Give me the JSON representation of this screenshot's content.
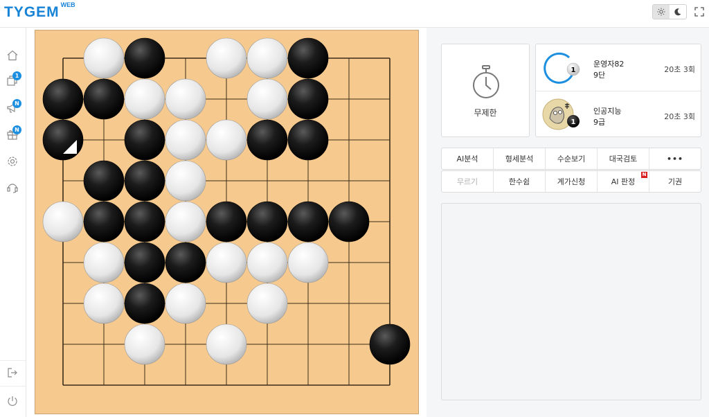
{
  "app": {
    "logo_text": "TYGEM",
    "logo_suffix": "WEB",
    "brand_color": "#1783d6"
  },
  "header": {
    "theme_light_icon": "sun-icon",
    "theme_dark_icon": "moon-icon",
    "fullscreen_icon": "fullscreen-icon"
  },
  "sidebar": {
    "items": [
      {
        "icon": "home-icon",
        "badge": ""
      },
      {
        "icon": "boxes-icon",
        "badge": "1"
      },
      {
        "icon": "megaphone-icon",
        "badge": "N"
      },
      {
        "icon": "gift-icon",
        "badge": "N"
      },
      {
        "icon": "settings-icon",
        "badge": ""
      },
      {
        "icon": "support-icon",
        "badge": ""
      }
    ],
    "bottom": [
      {
        "icon": "logout-icon"
      },
      {
        "icon": "power-icon"
      }
    ],
    "badge_color": "#1c8fe0"
  },
  "board": {
    "size": 9,
    "color": "#f6c98e",
    "stones": [
      {
        "c": "W",
        "col": 1,
        "row": 0
      },
      {
        "c": "B",
        "col": 2,
        "row": 0
      },
      {
        "c": "W",
        "col": 4,
        "row": 0
      },
      {
        "c": "W",
        "col": 5,
        "row": 0
      },
      {
        "c": "B",
        "col": 6,
        "row": 0
      },
      {
        "c": "B",
        "col": 0,
        "row": 1
      },
      {
        "c": "B",
        "col": 1,
        "row": 1
      },
      {
        "c": "W",
        "col": 2,
        "row": 1
      },
      {
        "c": "W",
        "col": 3,
        "row": 1
      },
      {
        "c": "W",
        "col": 5,
        "row": 1
      },
      {
        "c": "B",
        "col": 6,
        "row": 1
      },
      {
        "c": "B",
        "col": 0,
        "row": 2,
        "last": true
      },
      {
        "c": "B",
        "col": 2,
        "row": 2
      },
      {
        "c": "W",
        "col": 3,
        "row": 2
      },
      {
        "c": "W",
        "col": 4,
        "row": 2
      },
      {
        "c": "B",
        "col": 5,
        "row": 2
      },
      {
        "c": "B",
        "col": 6,
        "row": 2
      },
      {
        "c": "B",
        "col": 1,
        "row": 3
      },
      {
        "c": "B",
        "col": 2,
        "row": 3
      },
      {
        "c": "W",
        "col": 3,
        "row": 3
      },
      {
        "c": "W",
        "col": 0,
        "row": 4
      },
      {
        "c": "B",
        "col": 1,
        "row": 4
      },
      {
        "c": "B",
        "col": 2,
        "row": 4
      },
      {
        "c": "W",
        "col": 3,
        "row": 4
      },
      {
        "c": "B",
        "col": 4,
        "row": 4
      },
      {
        "c": "B",
        "col": 5,
        "row": 4
      },
      {
        "c": "B",
        "col": 6,
        "row": 4
      },
      {
        "c": "B",
        "col": 7,
        "row": 4
      },
      {
        "c": "W",
        "col": 1,
        "row": 5
      },
      {
        "c": "B",
        "col": 2,
        "row": 5
      },
      {
        "c": "B",
        "col": 3,
        "row": 5
      },
      {
        "c": "W",
        "col": 4,
        "row": 5
      },
      {
        "c": "W",
        "col": 5,
        "row": 5
      },
      {
        "c": "W",
        "col": 6,
        "row": 5
      },
      {
        "c": "W",
        "col": 1,
        "row": 6
      },
      {
        "c": "B",
        "col": 2,
        "row": 6
      },
      {
        "c": "W",
        "col": 3,
        "row": 6
      },
      {
        "c": "W",
        "col": 5,
        "row": 6
      },
      {
        "c": "W",
        "col": 2,
        "row": 7
      },
      {
        "c": "W",
        "col": 4,
        "row": 7
      },
      {
        "c": "B",
        "col": 8,
        "row": 7
      }
    ]
  },
  "timer": {
    "icon": "stopwatch-icon",
    "label": "무제한"
  },
  "players": [
    {
      "name": "운영자82",
      "rank": "9단",
      "time": "20초 3회",
      "stone": "W",
      "stone_number": "1",
      "avatar": "timer-ring-avatar",
      "accent": "#1c8fe0"
    },
    {
      "name": "인공지능",
      "rank": "9급",
      "time": "20초 3회",
      "stone": "B",
      "stone_number": "1",
      "avatar": "ai-character-avatar"
    }
  ],
  "tabs_row1": [
    "AI분석",
    "형세분석",
    "수순보기",
    "대국검토",
    "•••"
  ],
  "tabs_row2": [
    {
      "label": "무르기",
      "disabled": true
    },
    {
      "label": "한수쉼"
    },
    {
      "label": "계가신청"
    },
    {
      "label": "AI 판정",
      "new": "N"
    },
    {
      "label": "기권"
    }
  ]
}
